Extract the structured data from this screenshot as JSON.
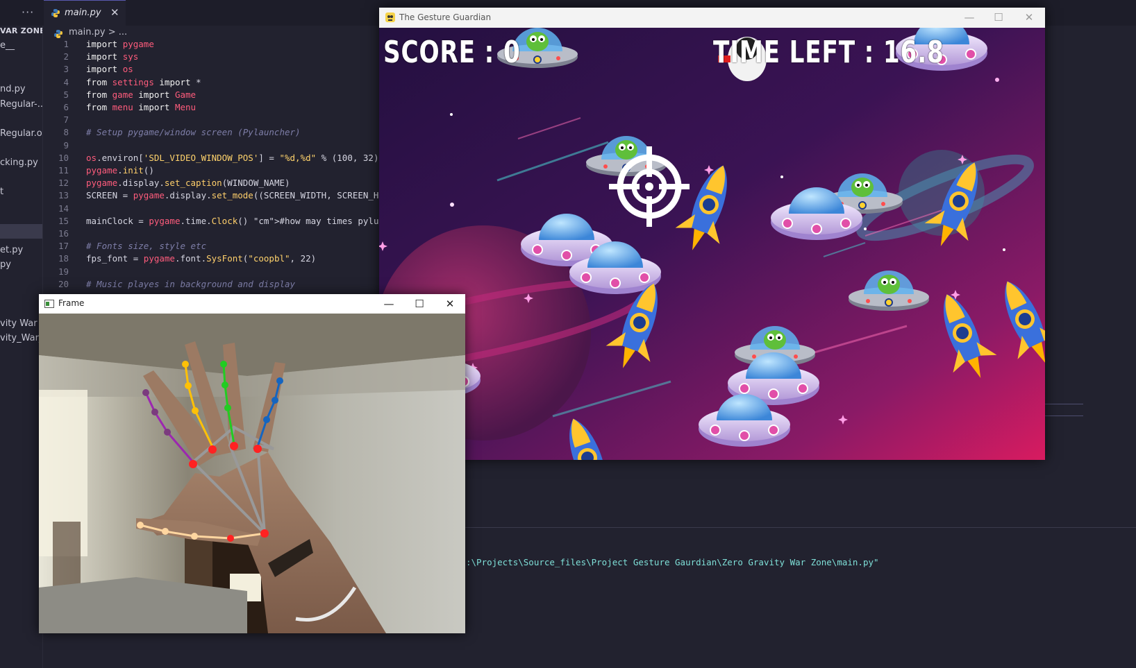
{
  "editor": {
    "more_label": "···",
    "tab": {
      "file_name": "main.py",
      "close_glyph": "✕",
      "icon": "python-file-icon"
    },
    "breadcrumb": {
      "file": "main.py",
      "sep": ">",
      "tail": "..."
    },
    "sidebar": {
      "items": [
        "VAR ZONE",
        "e__",
        "nd.py",
        "Regular-...",
        "Regular.otf",
        "cking.py",
        "t",
        "et.py",
        "py",
        "vity War ...",
        "vity_War_..."
      ]
    },
    "code": [
      {
        "n": "1",
        "t": "import pygame"
      },
      {
        "n": "2",
        "t": "import sys"
      },
      {
        "n": "3",
        "t": "import os"
      },
      {
        "n": "4",
        "t": "from settings import *"
      },
      {
        "n": "5",
        "t": "from game import Game"
      },
      {
        "n": "6",
        "t": "from menu import Menu"
      },
      {
        "n": "7",
        "t": ""
      },
      {
        "n": "8",
        "t": "# Setup pygame/window screen (Pylauncher)"
      },
      {
        "n": "9",
        "t": ""
      },
      {
        "n": "10",
        "t": "os.environ['SDL_VIDEO_WINDOW_POS'] = \"%d,%d\" % (100, 32)"
      },
      {
        "n": "11",
        "t": "pygame.init()"
      },
      {
        "n": "12",
        "t": "pygame.display.set_caption(WINDOW_NAME)"
      },
      {
        "n": "13",
        "t": "SCREEN = pygame.display.set_mode((SCREEN_WIDTH, SCREEN_HEI"
      },
      {
        "n": "14",
        "t": ""
      },
      {
        "n": "15",
        "t": "mainClock = pygame.time.Clock() #how may times pylunche"
      },
      {
        "n": "16",
        "t": ""
      },
      {
        "n": "17",
        "t": "# Fonts size, style etc"
      },
      {
        "n": "18",
        "t": "fps_font = pygame.font.SysFont(\"coopbl\", 22)"
      },
      {
        "n": "19",
        "t": ""
      },
      {
        "n": "20",
        "t": "# Music playes in background and display"
      }
    ],
    "terminal_path": ":\\Projects\\Source_files\\Project Gesture Gaurdian\\Zero Gravity War Zone\\main.py\""
  },
  "game_window": {
    "title": "The Gesture Guardian",
    "controls": {
      "minimize": "—",
      "maximize": "☐",
      "close": "✕"
    },
    "score_label": "SCORE : 0",
    "time_label": "TIME LEFT : 16.8",
    "colors": {
      "bg_top": "#2b1346",
      "bg_bottom": "#c2185b",
      "crosshair": "#ffffff"
    }
  },
  "frame_window": {
    "title": "Frame",
    "controls": {
      "minimize": "—",
      "maximize": "☐",
      "close": "✕"
    },
    "colors": {
      "thumb": "#ffd6a0",
      "index": "#9c27b0",
      "middle": "#ffc107",
      "ring": "#22cc22",
      "pinky": "#1565c0",
      "joint": "#ff2222",
      "palm": "#999999"
    }
  }
}
